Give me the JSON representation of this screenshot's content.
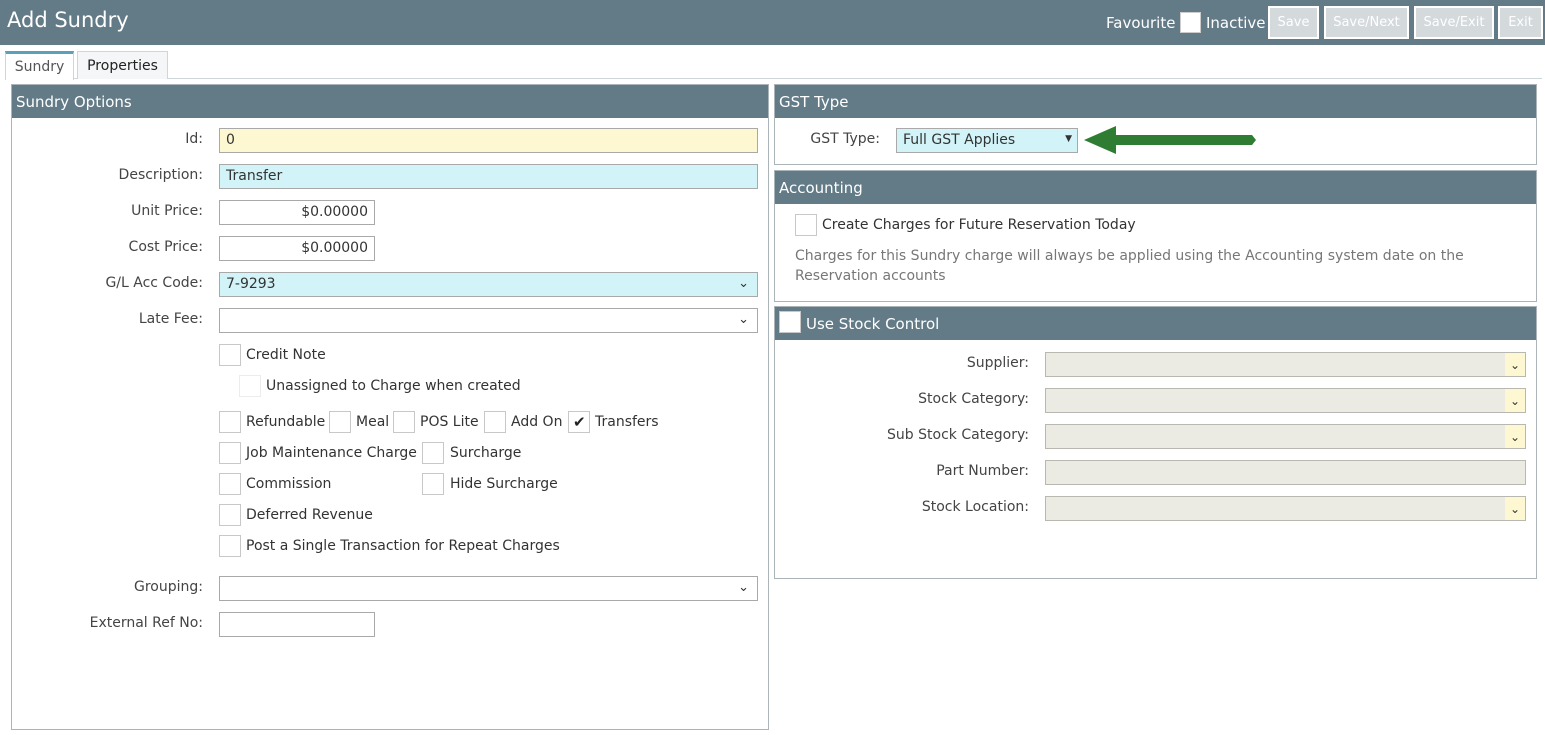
{
  "header": {
    "title": "Add Sundry",
    "favourite_label": "Favourite",
    "inactive_label": "Inactive",
    "buttons": {
      "save": "Save",
      "save_next": "Save/Next",
      "save_exit": "Save/Exit",
      "exit": "Exit"
    }
  },
  "tabs": [
    {
      "label": "Sundry",
      "active": true
    },
    {
      "label": "Properties",
      "active": false
    }
  ],
  "sundry_options": {
    "title": "Sundry Options",
    "id_label": "Id:",
    "id_value": "0",
    "description_label": "Description:",
    "description_value": "Transfer",
    "unit_price_label": "Unit Price:",
    "unit_price_value": "$0.00000",
    "cost_price_label": "Cost Price:",
    "cost_price_value": "$0.00000",
    "gl_label": "G/L Acc Code:",
    "gl_value": "7-9293",
    "late_fee_label": "Late Fee:",
    "late_fee_value": "",
    "credit_note": "Credit Note",
    "unassigned": "Unassigned to Charge when created",
    "refundable": "Refundable",
    "meal": "Meal",
    "pos_lite": "POS Lite",
    "add_on": "Add On",
    "transfers": "Transfers",
    "transfers_checked": true,
    "job_maintenance": "Job Maintenance Charge",
    "surcharge": "Surcharge",
    "commission": "Commission",
    "hide_surcharge": "Hide Surcharge",
    "deferred_revenue": "Deferred Revenue",
    "post_single": "Post a Single Transaction for Repeat Charges",
    "grouping_label": "Grouping:",
    "grouping_value": "",
    "external_ref_label": "External Ref No:",
    "external_ref_value": ""
  },
  "gst": {
    "title": "GST Type",
    "label": "GST Type:",
    "value": "Full GST Applies",
    "arrow_color": "#2e7d32"
  },
  "accounting": {
    "title": "Accounting",
    "create_charges": "Create Charges for Future Reservation Today",
    "note_line1": "Charges for this Sundry charge will always be applied using the Accounting system date on the",
    "note_line2": "Reservation accounts"
  },
  "stock": {
    "title": "Use Stock Control",
    "supplier_label": "Supplier:",
    "stock_category_label": "Stock Category:",
    "sub_stock_category_label": "Sub Stock Category:",
    "part_number_label": "Part Number:",
    "stock_location_label": "Stock Location:"
  },
  "colors": {
    "header": "#637a87",
    "yellow_field": "#fdf8d1",
    "cyan_field": "#d2f4f8",
    "tab_accent": "#5aa0b7"
  }
}
